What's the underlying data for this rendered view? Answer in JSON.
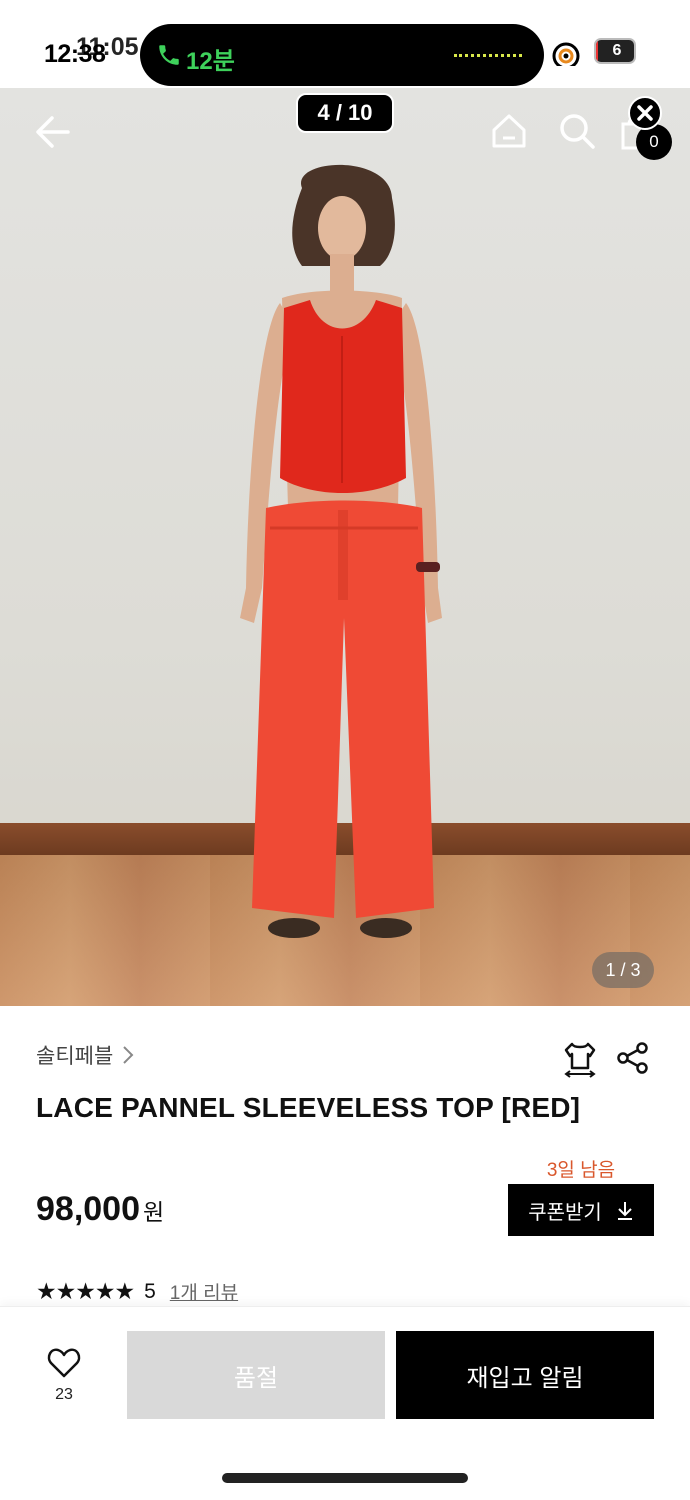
{
  "status_bar": {
    "time": "12:38",
    "time_ghost": "11:05",
    "call_label": "12분",
    "battery_text": "6",
    "battery_level": 0.06
  },
  "gallery": {
    "counter": "4 / 10",
    "image_indicator": "1 / 3",
    "cart_count": "0"
  },
  "product": {
    "brand": "솔티페블",
    "title": "LACE PANNEL SLEEVELESS TOP [RED]",
    "price": "98,000",
    "price_unit": "원",
    "coupon_deadline": "3일 남음",
    "coupon_label": "쿠폰받기",
    "stars": "★★★★★",
    "rating": "5",
    "review_link": "1개 리뷰"
  },
  "bottom_bar": {
    "wish_count": "23",
    "soldout_label": "품절",
    "restock_label": "재입고 알림"
  },
  "colors": {
    "accent": "#d9572c",
    "primary": "#000000",
    "disabled": "#d9d9d9",
    "call_green": "#3ed15b"
  }
}
